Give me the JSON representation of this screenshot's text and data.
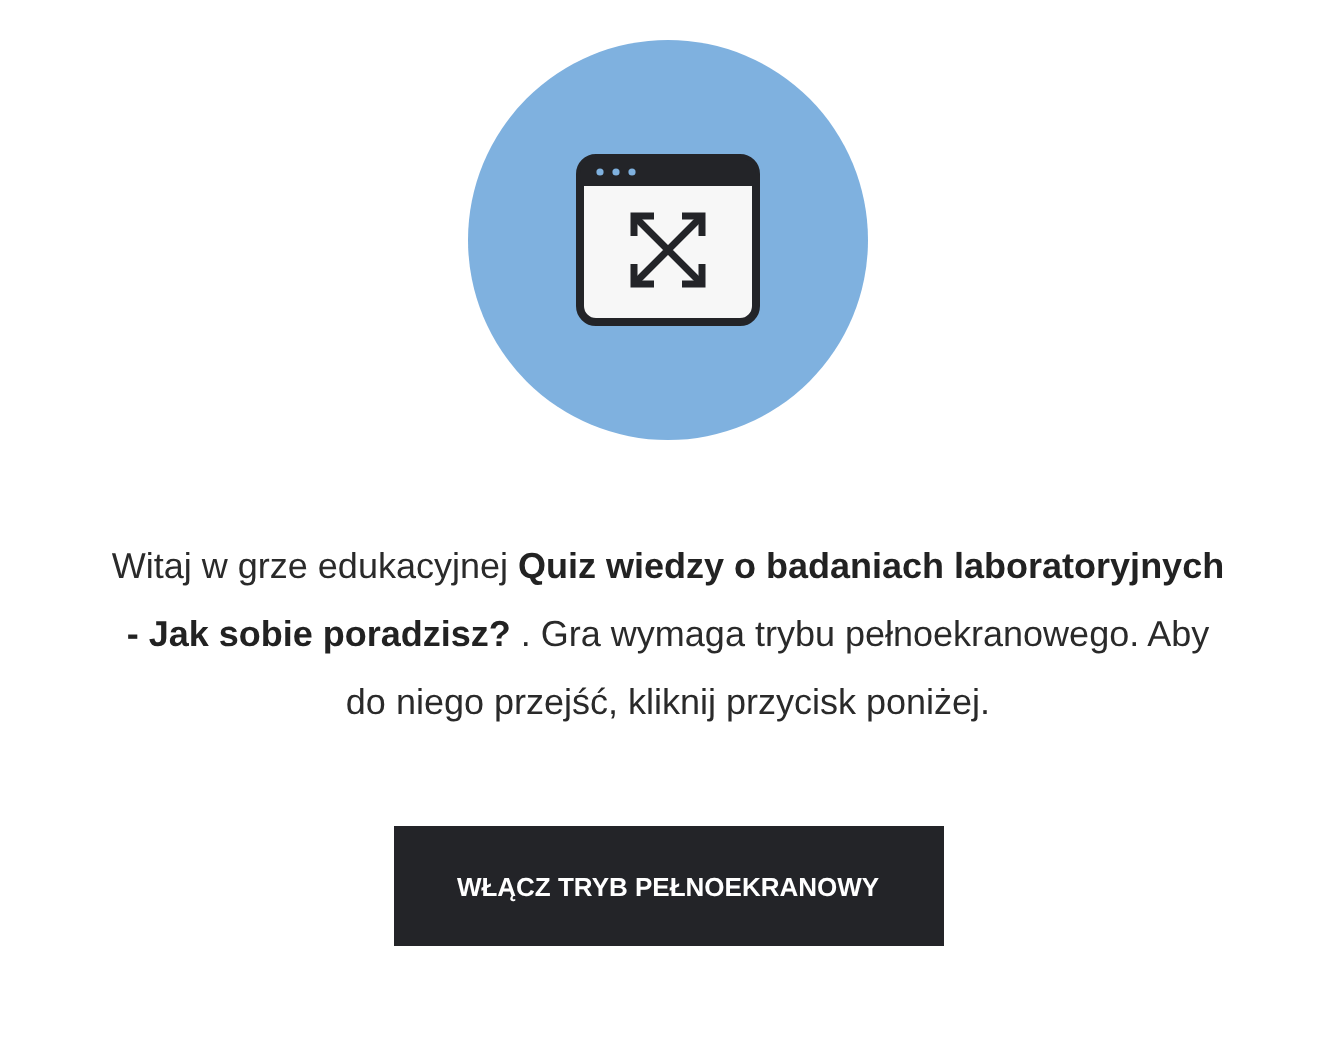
{
  "intro": {
    "text": "Witaj w grze edukacyjnej **Quiz wiedzy o badaniach laboratoryjnych - Jak sobie poradzisz?** . Gra wymaga trybu pełnoekranowego. Aby do niego przejść, kliknij przycisk poniżej."
  },
  "button": {
    "label": "WŁĄCZ TRYB PEŁNOEKRANOWY"
  }
}
